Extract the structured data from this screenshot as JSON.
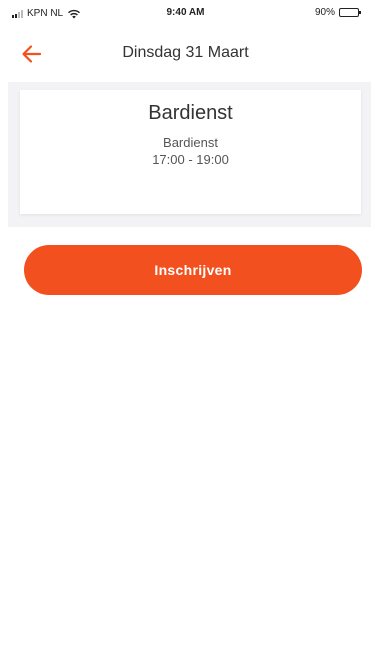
{
  "status_bar": {
    "carrier": "KPN NL",
    "time": "9:40 AM",
    "battery": "90%",
    "battery_level": 0.9
  },
  "nav": {
    "back_icon": "arrow-left-icon",
    "title": "Dinsdag 31 Maart"
  },
  "shift_card": {
    "title": "Bardienst",
    "subtitle": "Bardienst",
    "time": "17:00 - 19:00"
  },
  "signup_button": {
    "label": "Inschrijven"
  },
  "colors": {
    "accent": "#f2501e",
    "card_background": "#f3f3f5"
  }
}
